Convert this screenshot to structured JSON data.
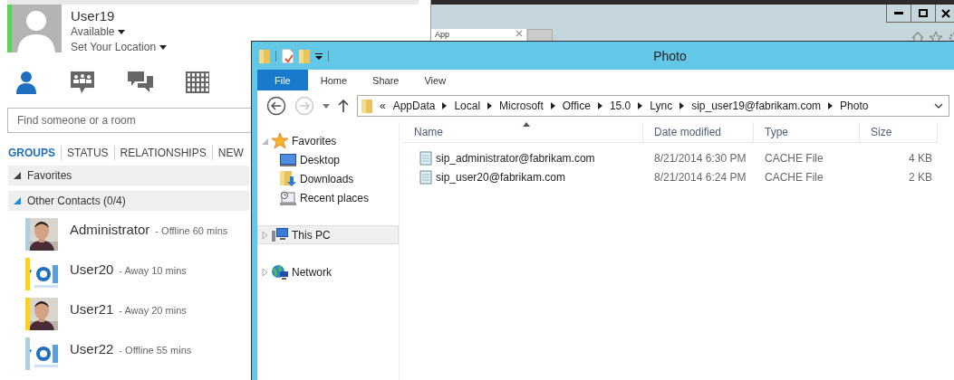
{
  "lync": {
    "user": {
      "name": "User19",
      "status": "Available",
      "location": "Set Your Location",
      "color": "#5ad454"
    },
    "nav_icons": [
      {
        "kind": "contacts",
        "selected": true
      },
      {
        "kind": "conversations",
        "selected": false
      },
      {
        "kind": "chat",
        "selected": false
      },
      {
        "kind": "calendar",
        "selected": false
      }
    ],
    "search": {
      "placeholder": "Find someone or a room"
    },
    "view_tabs": [
      {
        "label": "GROUPS",
        "selected": true
      },
      {
        "label": "STATUS",
        "selected": false
      },
      {
        "label": "RELATIONSHIPS",
        "selected": false
      },
      {
        "label": "NEW",
        "selected": false
      }
    ],
    "groups": [
      {
        "name": "Favorites",
        "expanded": false
      },
      {
        "name": "Other Contacts (0/4)",
        "expanded": true,
        "contacts": [
          {
            "name": "Administrator",
            "status": "- Offline 60 mins",
            "color": "#aecfdd"
          },
          {
            "name": "User20",
            "status": "- Away 10 mins",
            "color": "#fcd116"
          },
          {
            "name": "User21",
            "status": "- Away 20 mins",
            "color": "#fcd116"
          },
          {
            "name": "User22",
            "status": "- Offline 55 mins",
            "color": "#aecfdd"
          }
        ]
      }
    ]
  },
  "browser": {
    "tab": {
      "title": "App"
    }
  },
  "explorer": {
    "title": "Photo",
    "ribbon_tabs": [
      {
        "label": "File",
        "selected": true
      },
      {
        "label": "Home",
        "selected": false
      },
      {
        "label": "Share",
        "selected": false
      },
      {
        "label": "View",
        "selected": false
      }
    ],
    "nav_buttons": [
      {
        "kind": "back",
        "disabled": false
      },
      {
        "kind": "forward",
        "disabled": true
      }
    ],
    "address": {
      "prefix": "«",
      "crumbs": [
        "AppData",
        "Local",
        "Microsoft",
        "Office",
        "15.0",
        "Lync",
        "sip_user19@fabrikam.com",
        "Photo"
      ]
    },
    "nav_pane": [
      {
        "label": "Favorites",
        "kind": "favorites",
        "expanded": true,
        "selected": false,
        "children": [
          {
            "label": "Desktop",
            "kind": "desktop",
            "selected": false
          },
          {
            "label": "Downloads",
            "kind": "downloads",
            "selected": false
          },
          {
            "label": "Recent places",
            "kind": "recent",
            "selected": false
          }
        ]
      },
      {
        "label": "This PC",
        "kind": "pc",
        "expanded": false,
        "selected": true
      },
      {
        "label": "Network",
        "kind": "network",
        "expanded": false,
        "selected": false
      }
    ],
    "columns": [
      {
        "label": "Name",
        "sorted": true
      },
      {
        "label": "Date modified",
        "sorted": false
      },
      {
        "label": "Type",
        "sorted": false
      },
      {
        "label": "Size",
        "sorted": false
      }
    ],
    "files": [
      {
        "name": "sip_administrator@fabrikam.com",
        "date": "8/21/2014 6:30 PM",
        "type": "CACHE File",
        "size": "4 KB",
        "selected": false
      },
      {
        "name": "sip_user20@fabrikam.com",
        "date": "8/21/2014 6:24 PM",
        "type": "CACHE File",
        "size": "2 KB",
        "selected": false
      }
    ]
  }
}
